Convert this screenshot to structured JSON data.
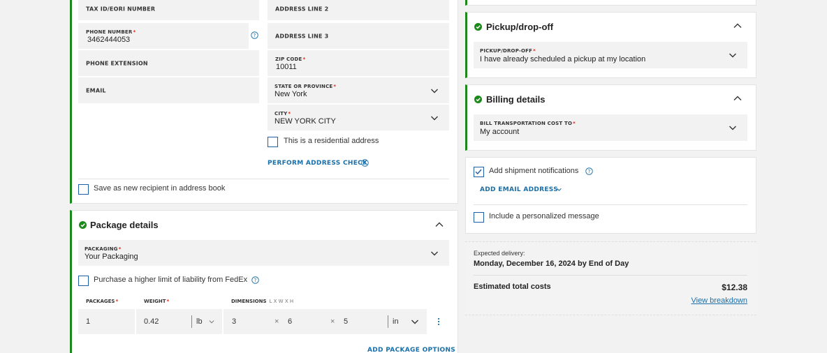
{
  "recipient": {
    "tax_id_label": "TAX ID/EORI NUMBER",
    "phone_label": "PHONE NUMBER",
    "phone_value": "3462444053",
    "phone_ext_label": "PHONE EXTENSION",
    "email_label": "EMAIL",
    "address2_label": "ADDRESS LINE 2",
    "address3_label": "ADDRESS LINE 3",
    "zip_label": "ZIP CODE",
    "zip_value": "10011",
    "state_label": "STATE OR PROVINCE",
    "state_value": "New York",
    "city_label": "CITY",
    "city_value": "NEW YORK CITY",
    "residential_label": "This is a residential address",
    "address_check_label": "PERFORM ADDRESS CHECK",
    "save_recipient_label": "Save as new recipient in address book"
  },
  "package": {
    "title": "Package details",
    "packaging_label": "PACKAGING",
    "packaging_value": "Your Packaging",
    "liability_label": "Purchase a higher limit of liability from FedEx",
    "packages_label": "PACKAGES",
    "weight_label": "WEIGHT",
    "dimensions_label": "DIMENSIONS",
    "dimensions_sub": "L x W x H",
    "packages_value": "1",
    "weight_value": "0.42",
    "weight_unit": "lb",
    "dim_l": "3",
    "dim_w": "6",
    "dim_h": "5",
    "dim_unit": "in",
    "dim_separator": "×",
    "add_options_label": "ADD PACKAGE OPTIONS"
  },
  "pickup": {
    "title": "Pickup/drop-off",
    "field_label": "PICKUP/DROP-OFF",
    "field_value": "I have already scheduled a pickup at my location"
  },
  "billing": {
    "title": "Billing details",
    "field_label": "BILL TRANSPORTATION COST TO",
    "field_value": "My account"
  },
  "notifications": {
    "add_notifications_label": "Add shipment notifications",
    "add_notifications_checked": true,
    "add_email_label": "ADD EMAIL ADDRESS",
    "personal_message_label": "Include a personalized message",
    "personal_message_checked": false
  },
  "summary": {
    "expected_label": "Expected delivery:",
    "expected_value": "Monday, December 16, 2024 by End of Day",
    "total_label": "Estimated total costs",
    "total_value": "$12.38",
    "breakdown_label": "View breakdown"
  },
  "colors": {
    "accent_green": "#1b8a1b",
    "link_blue": "#1a6fa8",
    "required_red": "#d21"
  }
}
